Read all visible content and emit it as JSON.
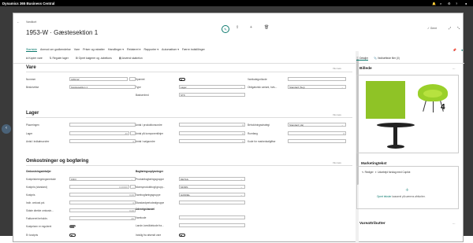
{
  "topbar": {
    "app": "Dynamics 365 Business Central"
  },
  "header": {
    "subtitle": "Vandkort",
    "title": "1953-W · Gæstesektion 1",
    "saved": "✓ Gemt"
  },
  "tabs": [
    "Startside",
    "Anmod om godkendelse",
    "Vare",
    "Priser og rabatter",
    "Handlinger ▾",
    "Relateret ▾",
    "Rapporter ▾",
    "Automatiser ▾",
    "Færre indstillinger"
  ],
  "actions": [
    "Kopier vare",
    "Reguler lager",
    "Opret kalgerer og -tabeltons",
    "Anvend skabelon"
  ],
  "sections": {
    "vare": "Vare",
    "lager": "Lager",
    "omk": "Omkostninger og bogføring",
    "more": "Vis mere",
    "sub1": "Omkostningsdetaljer",
    "sub2": "Bogføringsoplysninger",
    "sub3": "Udenrigshandel"
  },
  "vare": {
    "col1": [
      {
        "l": "Nummer",
        "v": "1953-W"
      },
      {
        "l": "Beskrivelse",
        "v": "Gæstesektion 1"
      }
    ],
    "col2": [
      {
        "l": "Spærret"
      },
      {
        "l": "Type",
        "v": "Lager"
      },
      {
        "l": "Basisenhed",
        "v": "STK"
      }
    ],
    "col3": [
      {
        "l": "Varekategorikode",
        "v": ""
      },
      {
        "l": "Obligatorisk variant, hvis...",
        "v": "Standard (Nej)"
      }
    ]
  },
  "lager": {
    "col1": [
      {
        "l": "Placeringen",
        "v": ""
      },
      {
        "l": "Lager",
        "v": "-40"
      },
      {
        "l": "Antal i indkøbsordrer",
        "v": "0"
      }
    ],
    "col2": [
      {
        "l": "Antal i produktionsordre",
        "v": "0"
      },
      {
        "l": "Antal på komponentlinjer",
        "v": "0"
      },
      {
        "l": "Antal i salgsordre",
        "v": "0"
      }
    ],
    "col3": [
      {
        "l": "Beholdningsstrategi",
        "v": "Standard (Ja)"
      },
      {
        "l": "Rumfang",
        "v": "0"
      },
      {
        "l": "Kode for markedsafgiftse",
        "v": ""
      }
    ]
  },
  "omk": {
    "col1": [
      {
        "l": "Kostprisberegningsmetode",
        "v": "FIFO"
      },
      {
        "l": "Kostpris (standard)",
        "v": "0,00000"
      },
      {
        "l": "Kostpris",
        "v": "0,00"
      },
      {
        "l": "Indir. omkost.pct.",
        "v": "0"
      },
      {
        "l": "Sidste direkte omkostn...",
        "v": "0,00"
      },
      {
        "l": "Faktureret beholdn.",
        "v": "-40"
      },
      {
        "l": "Kostprisen er reguleret"
      },
      {
        "l": "Er kostpris"
      }
    ],
    "col2": [
      {
        "l": "Produktbogføringsgruppe",
        "v": "DETAIL"
      },
      {
        "l": "Momsproduktbogf.grupp...",
        "v": "MOMS"
      },
      {
        "l": "Varebogføringsgruppe",
        "v": "HANDEL"
      },
      {
        "l": "Standardperiodeafgruppe",
        "v": ""
      },
      {
        "l": "Varekode",
        "v": ""
      },
      {
        "l": "Lande-/områdekode fra...",
        "v": ""
      },
      {
        "l": "Indsllg fra afsendt vare"
      }
    ]
  },
  "factbox": {
    "tabs": [
      "Detaljer",
      "Vedhæftede filer (0)"
    ],
    "picture": "Billede",
    "number_badge": "4",
    "marketing": "Marketingtekst",
    "edit": "Rediger",
    "create": "Udarbejd forslag med Copilot",
    "empty": "kasserel på uærens afrtiuriter.",
    "empty_link": "Opret tekster",
    "attributes": "Vareattributter"
  }
}
